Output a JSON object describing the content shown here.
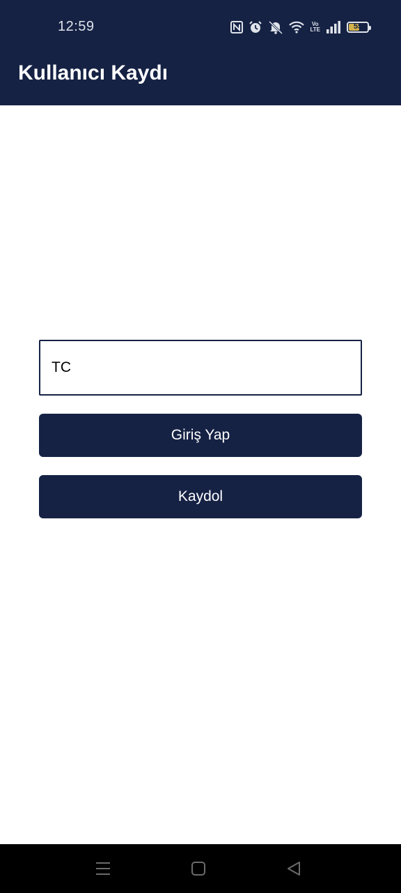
{
  "status_bar": {
    "time": "12:59",
    "icons": [
      "nfc-icon",
      "alarm-icon",
      "mute-icon",
      "wifi-icon",
      "volte-icon",
      "signal-icon",
      "battery-icon"
    ],
    "volte_label_top": "Vo",
    "volte_label_bottom": "LTE",
    "battery_level": "55"
  },
  "app_bar": {
    "title": "Kullanıcı Kaydı"
  },
  "form": {
    "tc_placeholder": "TC",
    "tc_value": "",
    "login_label": "Giriş Yap",
    "register_label": "Kaydol"
  },
  "nav_bar": {
    "icons": [
      "menu-icon",
      "home-icon",
      "back-icon"
    ]
  },
  "colors": {
    "primary": "#152244",
    "background": "#ffffff",
    "nav_background": "#000000"
  }
}
